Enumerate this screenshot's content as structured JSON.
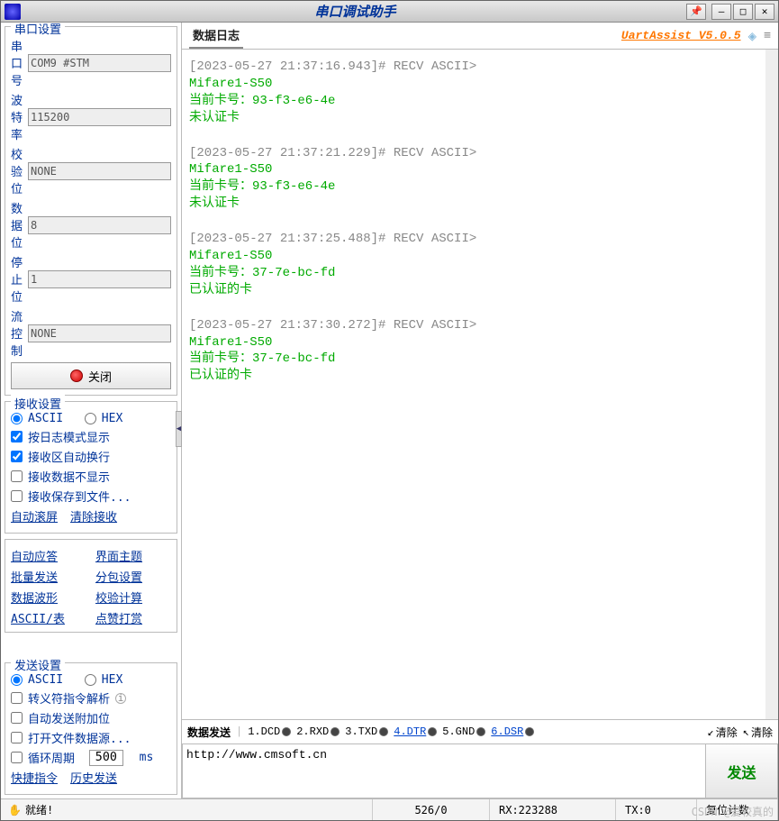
{
  "title": "串口调试助手",
  "brand": "UartAssist V5.0.5",
  "sidebar": {
    "port_group": "串口设置",
    "port_label": "串口号",
    "port_value": "COM9 #STM",
    "baud_label": "波特率",
    "baud_value": "115200",
    "parity_label": "校验位",
    "parity_value": "NONE",
    "data_label": "数据位",
    "data_value": "8",
    "stop_label": "停止位",
    "stop_value": "1",
    "flow_label": "流控制",
    "flow_value": "NONE",
    "close_btn": "关闭",
    "recv_group": "接收设置",
    "recv_ascii": "ASCII",
    "recv_hex": "HEX",
    "recv_logmode": "按日志模式显示",
    "recv_wrap": "接收区自动换行",
    "recv_hide": "接收数据不显示",
    "recv_save": "接收保存到文件...",
    "auto_scroll": "自动滚屏",
    "clear_recv": "清除接收",
    "tools": {
      "auto_reply": "自动应答",
      "theme": "界面主题",
      "batch_send": "批量发送",
      "split": "分包设置",
      "wave": "数据波形",
      "checksum": "校验计算",
      "ascii_table": "ASCII/表",
      "donate": "点赞打赏"
    },
    "send_group": "发送设置",
    "send_ascii": "ASCII",
    "send_hex": "HEX",
    "escape": "转义符指令解析",
    "auto_append": "自动发送附加位",
    "open_file": "打开文件数据源...",
    "cycle": "循环周期",
    "cycle_val": "500",
    "ms": "ms",
    "shortcut": "快捷指令",
    "history": "历史发送"
  },
  "log": {
    "header": "数据日志",
    "entries": [
      {
        "ts": "[2023-05-27 21:37:16.943]# RECV ASCII>",
        "l1": "Mifare1-S50",
        "l2": "当前卡号：93-f3-e6-4e",
        "l3": "未认证卡"
      },
      {
        "ts": "[2023-05-27 21:37:21.229]# RECV ASCII>",
        "l1": "Mifare1-S50",
        "l2": "当前卡号：93-f3-e6-4e",
        "l3": "未认证卡"
      },
      {
        "ts": "[2023-05-27 21:37:25.488]# RECV ASCII>",
        "l1": "Mifare1-S50",
        "l2": "当前卡号：37-7e-bc-fd",
        "l3": "已认证的卡"
      },
      {
        "ts": "[2023-05-27 21:37:30.272]# RECV ASCII>",
        "l1": "Mifare1-S50",
        "l2": "当前卡号：37-7e-bc-fd",
        "l3": "已认证的卡"
      }
    ]
  },
  "send": {
    "header": "数据发送",
    "sig1": "1.DCD",
    "sig2": "2.RXD",
    "sig3": "3.TXD",
    "sig4": "4.DTR",
    "sig5": "5.GND",
    "sig6": "6.DSR",
    "clear1": "清除",
    "clear2": "清除",
    "input": "http://www.cmsoft.cn",
    "btn": "发送"
  },
  "status": {
    "ready": "就绪!",
    "counts": "526/0",
    "rx": "RX:223288",
    "tx": "TX:0",
    "reset": "复位计数"
  },
  "watermark": "CSDN @爱较真的"
}
